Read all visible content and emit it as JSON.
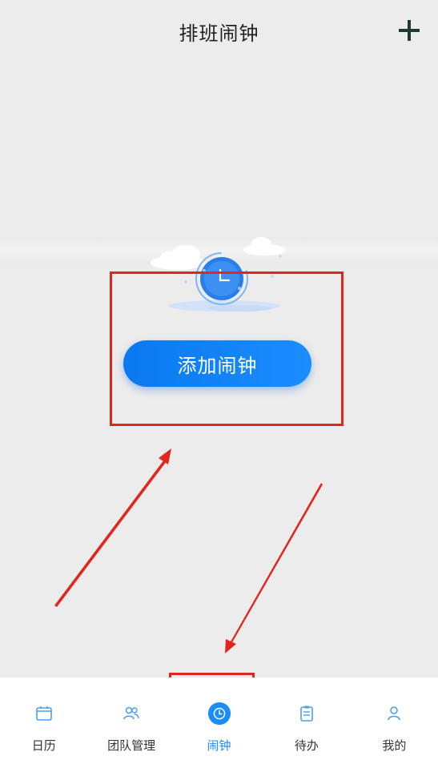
{
  "header": {
    "title": "排班闹钟",
    "add_icon": "plus-icon"
  },
  "empty_state": {
    "illustration": "clock-icon",
    "button_label": "添加闹钟"
  },
  "colors": {
    "accent": "#1a8dfd",
    "annotation": "#e0261f"
  },
  "tabs": [
    {
      "label": "日历",
      "icon": "calendar-icon",
      "active": false
    },
    {
      "label": "团队管理",
      "icon": "team-icon",
      "active": false
    },
    {
      "label": "闹钟",
      "icon": "clock-icon",
      "active": true
    },
    {
      "label": "待办",
      "icon": "clipboard-icon",
      "active": false
    },
    {
      "label": "我的",
      "icon": "user-icon",
      "active": false
    }
  ]
}
